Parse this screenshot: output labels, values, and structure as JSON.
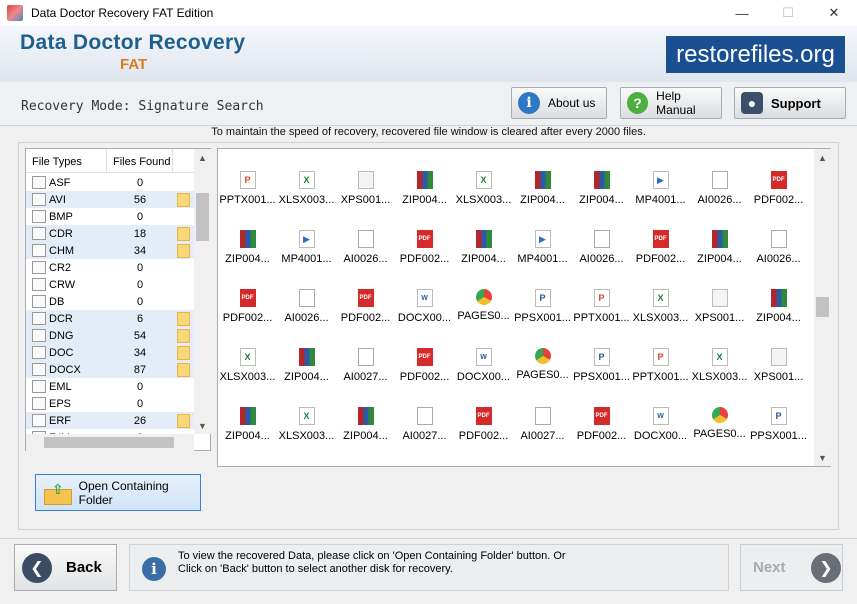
{
  "window": {
    "title": "Data Doctor Recovery FAT Edition",
    "minimize": "—",
    "maximize": "☐",
    "close": "✕"
  },
  "header": {
    "brand_main": "Data Doctor Recovery",
    "brand_sub": "FAT",
    "site": "restorefiles.org"
  },
  "mode_bar": {
    "mode_text": "Recovery Mode: Signature Search",
    "about_label": "About us",
    "help_label": "Help Manual",
    "support_label": "Support"
  },
  "notice": "To maintain the speed of recovery, recovered file window is cleared after every 2000 files.",
  "file_types": {
    "col_type": "File Types",
    "col_count": "Files Found",
    "rows": [
      {
        "type": "ASF",
        "count": "0",
        "folder": false
      },
      {
        "type": "AVI",
        "count": "56",
        "folder": true
      },
      {
        "type": "BMP",
        "count": "0",
        "folder": false
      },
      {
        "type": "CDR",
        "count": "18",
        "folder": true
      },
      {
        "type": "CHM",
        "count": "34",
        "folder": true
      },
      {
        "type": "CR2",
        "count": "0",
        "folder": false
      },
      {
        "type": "CRW",
        "count": "0",
        "folder": false
      },
      {
        "type": "DB",
        "count": "0",
        "folder": false
      },
      {
        "type": "DCR",
        "count": "6",
        "folder": true
      },
      {
        "type": "DNG",
        "count": "54",
        "folder": true
      },
      {
        "type": "DOC",
        "count": "34",
        "folder": true
      },
      {
        "type": "DOCX",
        "count": "87",
        "folder": true
      },
      {
        "type": "EML",
        "count": "0",
        "folder": false
      },
      {
        "type": "EPS",
        "count": "0",
        "folder": false
      },
      {
        "type": "ERF",
        "count": "26",
        "folder": true
      },
      {
        "type": "F4V",
        "count": "0",
        "folder": false
      }
    ]
  },
  "open_folder_label": "Open Containing Folder",
  "files": [
    {
      "name": "PPTX001...",
      "kind": "pptx"
    },
    {
      "name": "XLSX003...",
      "kind": "xlsx"
    },
    {
      "name": "XPS001...",
      "kind": "xps"
    },
    {
      "name": "ZIP004...",
      "kind": "zip"
    },
    {
      "name": "XLSX003...",
      "kind": "xlsx"
    },
    {
      "name": "ZIP004...",
      "kind": "zip"
    },
    {
      "name": "ZIP004...",
      "kind": "zip"
    },
    {
      "name": "MP4001...",
      "kind": "mp4"
    },
    {
      "name": "AI0026...",
      "kind": "ai"
    },
    {
      "name": "PDF002...",
      "kind": "pdf"
    },
    {
      "name": "ZIP004...",
      "kind": "zip"
    },
    {
      "name": "MP4001...",
      "kind": "mp4"
    },
    {
      "name": "AI0026...",
      "kind": "ai"
    },
    {
      "name": "PDF002...",
      "kind": "pdf"
    },
    {
      "name": "ZIP004...",
      "kind": "zip"
    },
    {
      "name": "MP4001...",
      "kind": "mp4"
    },
    {
      "name": "AI0026...",
      "kind": "ai"
    },
    {
      "name": "PDF002...",
      "kind": "pdf"
    },
    {
      "name": "ZIP004...",
      "kind": "zip"
    },
    {
      "name": "AI0026...",
      "kind": "ai"
    },
    {
      "name": "PDF002...",
      "kind": "pdf"
    },
    {
      "name": "AI0026...",
      "kind": "ai"
    },
    {
      "name": "PDF002...",
      "kind": "pdf"
    },
    {
      "name": "DOCX00...",
      "kind": "docx"
    },
    {
      "name": "PAGES0...",
      "kind": "pages"
    },
    {
      "name": "PPSX001...",
      "kind": "ppsx"
    },
    {
      "name": "PPTX001...",
      "kind": "pptx"
    },
    {
      "name": "XLSX003...",
      "kind": "xlsx"
    },
    {
      "name": "XPS001...",
      "kind": "xps"
    },
    {
      "name": "ZIP004...",
      "kind": "zip"
    },
    {
      "name": "XLSX003...",
      "kind": "xlsx"
    },
    {
      "name": "ZIP004...",
      "kind": "zip"
    },
    {
      "name": "AI0027...",
      "kind": "ai"
    },
    {
      "name": "PDF002...",
      "kind": "pdf"
    },
    {
      "name": "DOCX00...",
      "kind": "docx"
    },
    {
      "name": "PAGES0...",
      "kind": "pages"
    },
    {
      "name": "PPSX001...",
      "kind": "ppsx"
    },
    {
      "name": "PPTX001...",
      "kind": "pptx"
    },
    {
      "name": "XLSX003...",
      "kind": "xlsx"
    },
    {
      "name": "XPS001...",
      "kind": "xps"
    },
    {
      "name": "ZIP004...",
      "kind": "zip"
    },
    {
      "name": "XLSX003...",
      "kind": "xlsx"
    },
    {
      "name": "ZIP004...",
      "kind": "zip"
    },
    {
      "name": "AI0027...",
      "kind": "ai"
    },
    {
      "name": "PDF002...",
      "kind": "pdf"
    },
    {
      "name": "AI0027...",
      "kind": "ai"
    },
    {
      "name": "PDF002...",
      "kind": "pdf"
    },
    {
      "name": "DOCX00...",
      "kind": "docx"
    },
    {
      "name": "PAGES0...",
      "kind": "pages"
    },
    {
      "name": "PPSX001...",
      "kind": "ppsx"
    }
  ],
  "footer": {
    "back_label": "Back",
    "info_line1": "To view the recovered Data, please click on 'Open Containing Folder' button. Or",
    "info_line2": "Click on 'Back' button to select another disk for recovery.",
    "next_label": "Next"
  },
  "colors": {
    "brand_blue": "#1f5f8f",
    "brand_orange": "#e07a1f",
    "site_banner": "#1a4f92"
  }
}
